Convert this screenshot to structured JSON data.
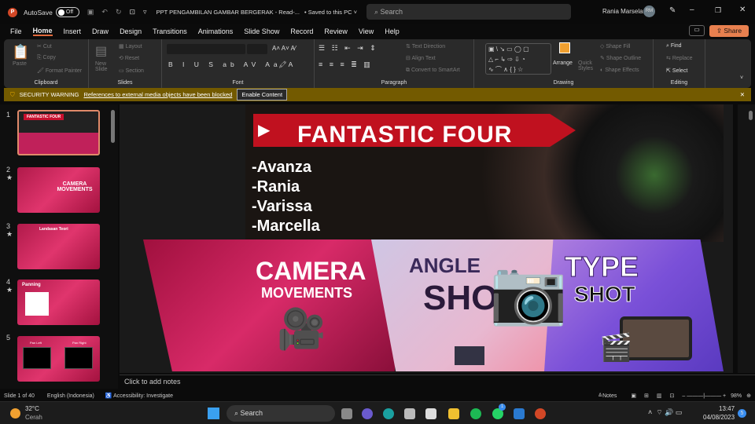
{
  "titlebar": {
    "autosave": "AutoSave",
    "toggle": "Off",
    "doc_title": "PPT PENGAMBILAN GAMBAR BERGERAK  -  Read-...",
    "saved": "• Saved to this PC ˅",
    "search": "Search",
    "user": "Rania Marsela",
    "initials": "RM"
  },
  "menu": [
    "File",
    "Home",
    "Insert",
    "Draw",
    "Design",
    "Transitions",
    "Animations",
    "Slide Show",
    "Record",
    "Review",
    "View",
    "Help"
  ],
  "share": "Share",
  "ribbon": {
    "clipboard": {
      "label": "Clipboard",
      "paste": "Paste",
      "cut": "Cut",
      "copy": "Copy",
      "format_painter": "Format Painter"
    },
    "slides": {
      "label": "Slides",
      "new_slide": "New Slide",
      "layout": "Layout",
      "reset": "Reset",
      "section": "Section"
    },
    "font": {
      "label": "Font"
    },
    "paragraph": {
      "label": "Paragraph",
      "text_direction": "Text Direction",
      "align_text": "Align Text",
      "smartart": "Convert to SmartArt"
    },
    "drawing": {
      "label": "Drawing",
      "arrange": "Arrange",
      "quick_styles": "Quick Styles",
      "shape_fill": "Shape Fill",
      "shape_outline": "Shape Outline",
      "shape_effects": "Shape Effects"
    },
    "editing": {
      "label": "Editing",
      "find": "Find",
      "replace": "Replace",
      "select": "Select"
    }
  },
  "warning": {
    "title": "SECURITY WARNING",
    "message": "References to external media objects have been blocked",
    "button": "Enable Content"
  },
  "thumbnails": [
    {
      "num": "1",
      "title": "FANTASTIC FOUR"
    },
    {
      "num": "2",
      "title": "CAMERA MOVEMENTS"
    },
    {
      "num": "3",
      "title": "Landasan Teori"
    },
    {
      "num": "4",
      "title": "Panning"
    },
    {
      "num": "5",
      "left": "Pan Left",
      "right": "Pan Right"
    }
  ],
  "slide": {
    "title": "FANTASTIC FOUR",
    "members": [
      "-Avanza",
      "-Rania",
      "-Varissa",
      "-Marcella"
    ],
    "camera": "CAMERA",
    "movements": "MOVEMENTS",
    "angle": "ANGLE",
    "angle_shot": "SHOT",
    "type": "TYPE",
    "type_shot": "SHOT"
  },
  "notes_placeholder": "Click to add notes",
  "status": {
    "slide": "Slide 1 of 40",
    "language": "English (Indonesia)",
    "accessibility": "Accessibility: Investigate",
    "notes": "Notes",
    "zoom": "98%"
  },
  "taskbar": {
    "temp": "32°C",
    "weather": "Cerah",
    "search": "Search",
    "time": "13:47",
    "date": "04/08/2023",
    "badge": "5",
    "whatsapp_badge": "1"
  }
}
